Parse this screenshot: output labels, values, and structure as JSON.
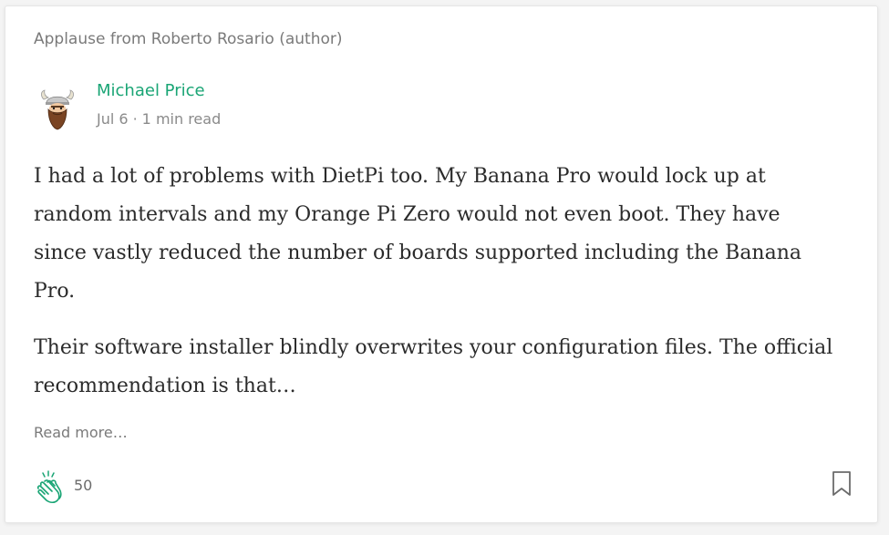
{
  "context_label": "Applause from Roberto Rosario (author)",
  "author": {
    "name": "Michael Price",
    "date": "Jul 6",
    "separator": "·",
    "read_time": "1 min read"
  },
  "body": {
    "paragraphs": [
      "I had a lot of problems with DietPi too. My Banana Pro would lock up at random intervals and my Orange Pi Zero would not even boot. They have since vastly reduced the number of boards supported including the Banana Pro.",
      "Their software installer blindly overwrites your configuration files. The official recommendation is that…"
    ]
  },
  "read_more_label": "Read more…",
  "actions": {
    "clap_count": "50",
    "clap_icon": "clap-icon",
    "bookmark_icon": "bookmark-icon"
  },
  "colors": {
    "accent": "#1aa575",
    "muted": "#7a7a7a",
    "text": "#2b2b2b"
  }
}
